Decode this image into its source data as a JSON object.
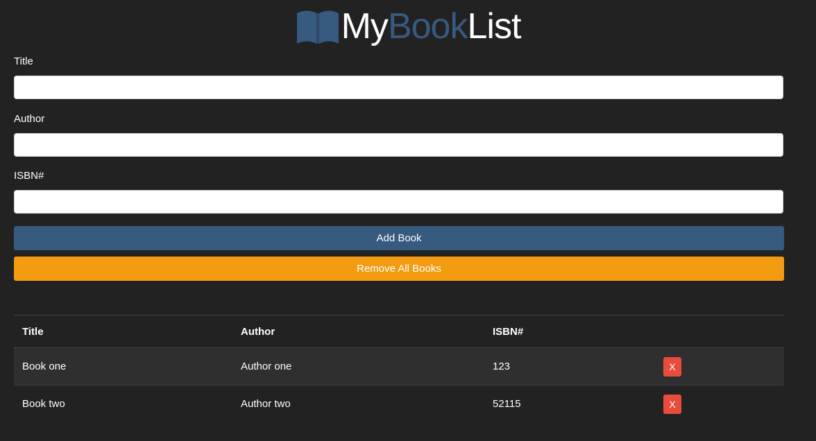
{
  "brand": {
    "part1": "My",
    "part2": "Book",
    "part3": "List"
  },
  "form": {
    "title_label": "Title",
    "title_value": "",
    "author_label": "Author",
    "author_value": "",
    "isbn_label": "ISBN#",
    "isbn_value": "",
    "add_button": "Add Book",
    "remove_all_button": "Remove All Books"
  },
  "table": {
    "headers": [
      "Title",
      "Author",
      "ISBN#"
    ],
    "rows": [
      {
        "title": "Book one",
        "author": "Author one",
        "isbn": "123",
        "delete": "X"
      },
      {
        "title": "Book two",
        "author": "Author two",
        "isbn": "52115",
        "delete": "X"
      }
    ]
  },
  "colors": {
    "background": "#222222",
    "primary": "#375a7f",
    "warning": "#f39c12",
    "danger": "#e74c3c"
  },
  "icons": {
    "logo": "open-book-icon"
  }
}
